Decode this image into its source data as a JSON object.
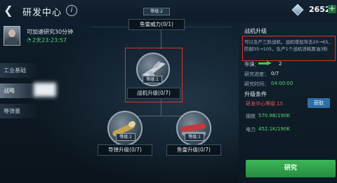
{
  "header": {
    "title": "研发中心",
    "info_icon": "i",
    "crystal_amount": "2652",
    "plus_label": "+"
  },
  "player": {
    "speedup_text": "可加速研究30分钟",
    "timer": "2天23:23:57"
  },
  "tabs": [
    {
      "label": "工业基础"
    },
    {
      "label": "战略"
    },
    {
      "label": "尊弹量"
    }
  ],
  "tree": {
    "top_level": "等级:2",
    "top_label": "鱼雷威力(0/1)",
    "center_badge": "等级:1",
    "center_label": "战机升级(0/7)",
    "left_badge": "等级:1",
    "left_label": "导弹升级(0/7)",
    "right_badge": "等级:1",
    "right_label": "鱼雷升级(0/7)"
  },
  "detail": {
    "title": "战机升级",
    "description": "可以生产三阶战机，战机增加攻击20→65，防御35→105，生产1个战机消耗原油3秒",
    "level_label": "等级：",
    "level_from": "1",
    "level_to": "2",
    "progress_label": "研究进度：",
    "progress_value": "0/7",
    "time_label": "研究时间：",
    "time_value": "04:00:00",
    "upgrade_conditions": "升级条件",
    "req_label": "研发中心等级.15",
    "acquire_label": "获取",
    "steel_label": "钢铁",
    "steel_value": "570.8B/190K",
    "oil_label": "电力",
    "oil_value": "452.1K/190K",
    "research_button": "研究"
  },
  "colors": {
    "accent_green": "#3db65a",
    "highlight_red": "#d8332e",
    "blue_button": "#2f6fa8"
  }
}
